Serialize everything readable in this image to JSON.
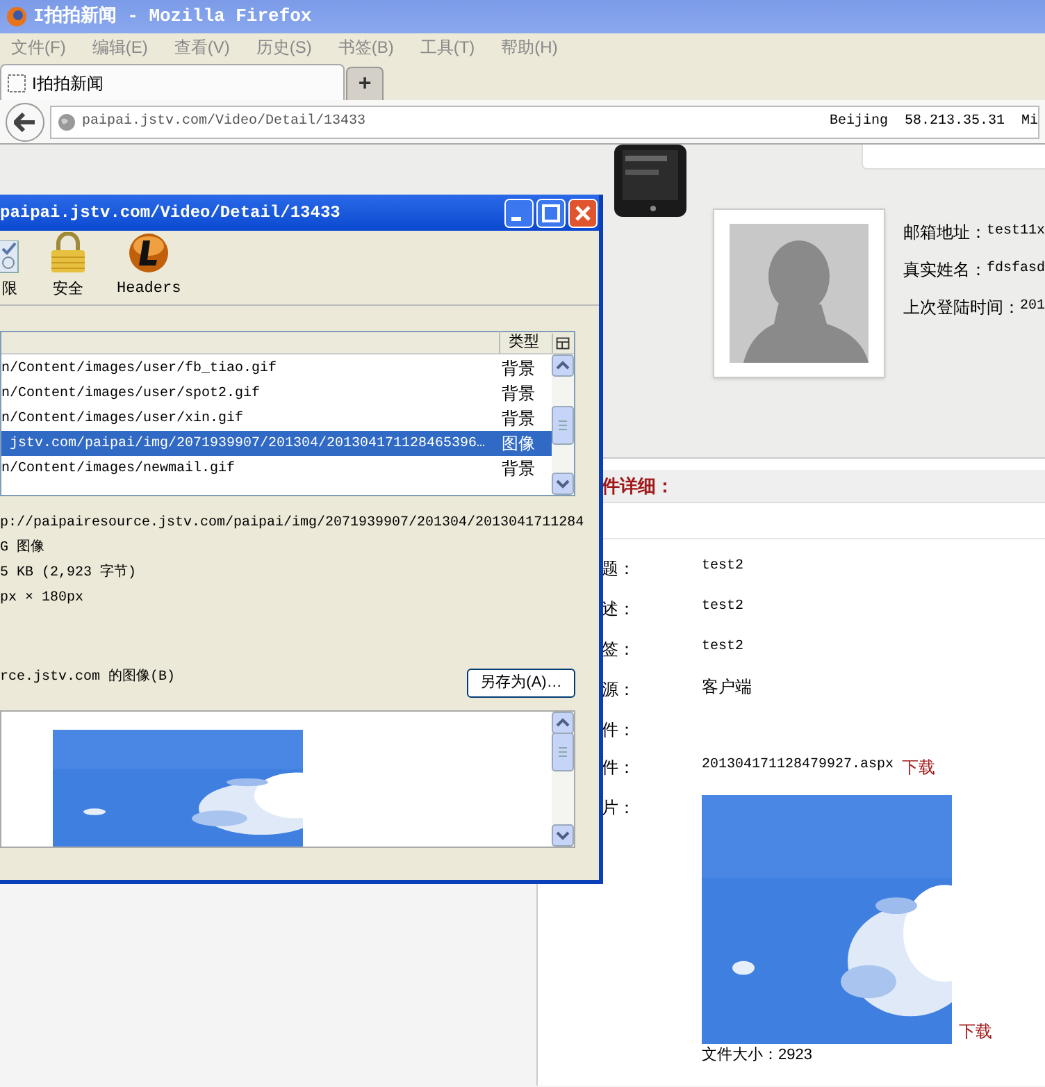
{
  "window": {
    "title": "I拍拍新闻 - Mozilla Firefox"
  },
  "menu_bar": [
    "文件(F)",
    "编辑(E)",
    "查看(V)",
    "历史(S)",
    "书签(B)",
    "工具(T)",
    "帮助(H)"
  ],
  "tabs": [
    {
      "label": "I拍拍新闻",
      "selected": true
    }
  ],
  "new_tab_button": "+",
  "address_bar": {
    "url": "paipai.jstv.com/Video/Detail/13433",
    "extension_text": "Beijing  58.213.35.31  Mi"
  },
  "page": {
    "profile_fields": [
      {
        "label": "邮箱地址：",
        "value": "test11x"
      },
      {
        "label": "真实姓名：",
        "value": "fdsfasd"
      },
      {
        "label": "上次登陆时间：",
        "value": "201"
      }
    ],
    "section_title": "件详细：",
    "details": [
      {
        "kind": "text",
        "label": "题：",
        "value": "test2"
      },
      {
        "kind": "text",
        "label": "述：",
        "value": "test2"
      },
      {
        "kind": "text",
        "label": "签：",
        "value": "test2"
      },
      {
        "kind": "text",
        "label": "源：",
        "value": "客户端"
      },
      {
        "kind": "empty",
        "label": "件："
      },
      {
        "kind": "file",
        "label": "件：",
        "value": "201304171128479927.aspx",
        "link": "下载"
      },
      {
        "label": "片：",
        "link": "下载",
        "caption": "文件大小：2923"
      }
    ]
  },
  "dialog": {
    "title": "paipai.jstv.com/Video/Detail/13433",
    "toolbar": [
      {
        "kind": "permissions",
        "label": "限"
      },
      {
        "kind": "security",
        "label": "安全"
      },
      {
        "kind": "headers",
        "label": "Headers"
      }
    ],
    "list_column": "类型",
    "rows": [
      {
        "address": "n/Content/images/user/fb_tiao.gif",
        "type": "背景",
        "selected": false
      },
      {
        "address": "n/Content/images/user/spot2.gif",
        "type": "背景",
        "selected": false
      },
      {
        "address": "n/Content/images/user/xin.gif",
        "type": "背景",
        "selected": false
      },
      {
        "address": " jstv.com/paipai/img/2071939907/201304/201304171128465396…",
        "type": "图像",
        "selected": true
      },
      {
        "address": "n/Content/images/newmail.gif",
        "type": "背景",
        "selected": false
      }
    ],
    "info_lines": [
      "p://paipairesource.jstv.com/paipai/img/2071939907/201304/2013041711284",
      "G 图像",
      "5 KB (2,923 字节)",
      "px × 180px"
    ],
    "source_line": "rce.jstv.com 的图像(B)",
    "save_button": "另存为(A)…"
  }
}
